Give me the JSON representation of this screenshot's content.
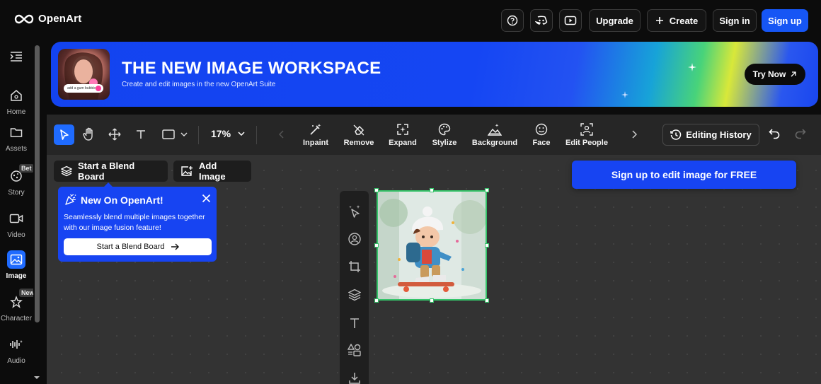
{
  "header": {
    "logo_text": "OpenArt",
    "icons": [
      "help-icon",
      "discord-icon",
      "youtube-icon"
    ],
    "upgrade_label": "Upgrade",
    "create_label": "Create",
    "signin_label": "Sign in",
    "signup_label": "Sign up"
  },
  "sidebar": {
    "items": [
      {
        "label": "Home",
        "icon": "home-icon"
      },
      {
        "label": "Assets",
        "icon": "folder-icon"
      },
      {
        "label": "Story",
        "icon": "story-icon",
        "badge": "Bet"
      },
      {
        "label": "Video",
        "icon": "video-icon"
      },
      {
        "label": "Image",
        "icon": "image-icon",
        "active": true
      },
      {
        "label": "Character",
        "icon": "character-icon",
        "badge": "New"
      },
      {
        "label": "Audio",
        "icon": "audio-icon"
      }
    ]
  },
  "banner": {
    "title": "THE NEW IMAGE WORKSPACE",
    "subtitle": "Create and edit images in the new OpenArt Suite",
    "thumb_caption": "add a gum bubble",
    "cta_label": "Try Now"
  },
  "toolbar": {
    "zoom": "17%",
    "edit_tools": [
      "Inpaint",
      "Remove",
      "Expand",
      "Stylize",
      "Background",
      "Face",
      "Edit People"
    ],
    "history_label": "Editing History"
  },
  "workspace": {
    "blend_board_label": "Start a Blend Board",
    "add_image_label": "Add Image",
    "signup_edit_label": "Sign up to edit image for FREE"
  },
  "popup": {
    "title": "New On OpenArt!",
    "body": "Seamlessly blend multiple images together with our image fusion feature!",
    "button_label": "Start a Blend Board"
  },
  "colors": {
    "accent": "#1f6bff",
    "brand_blue": "#1744f2",
    "selection_green": "#36c46a",
    "background": "#0c0c0c",
    "canvas": "#333333"
  }
}
